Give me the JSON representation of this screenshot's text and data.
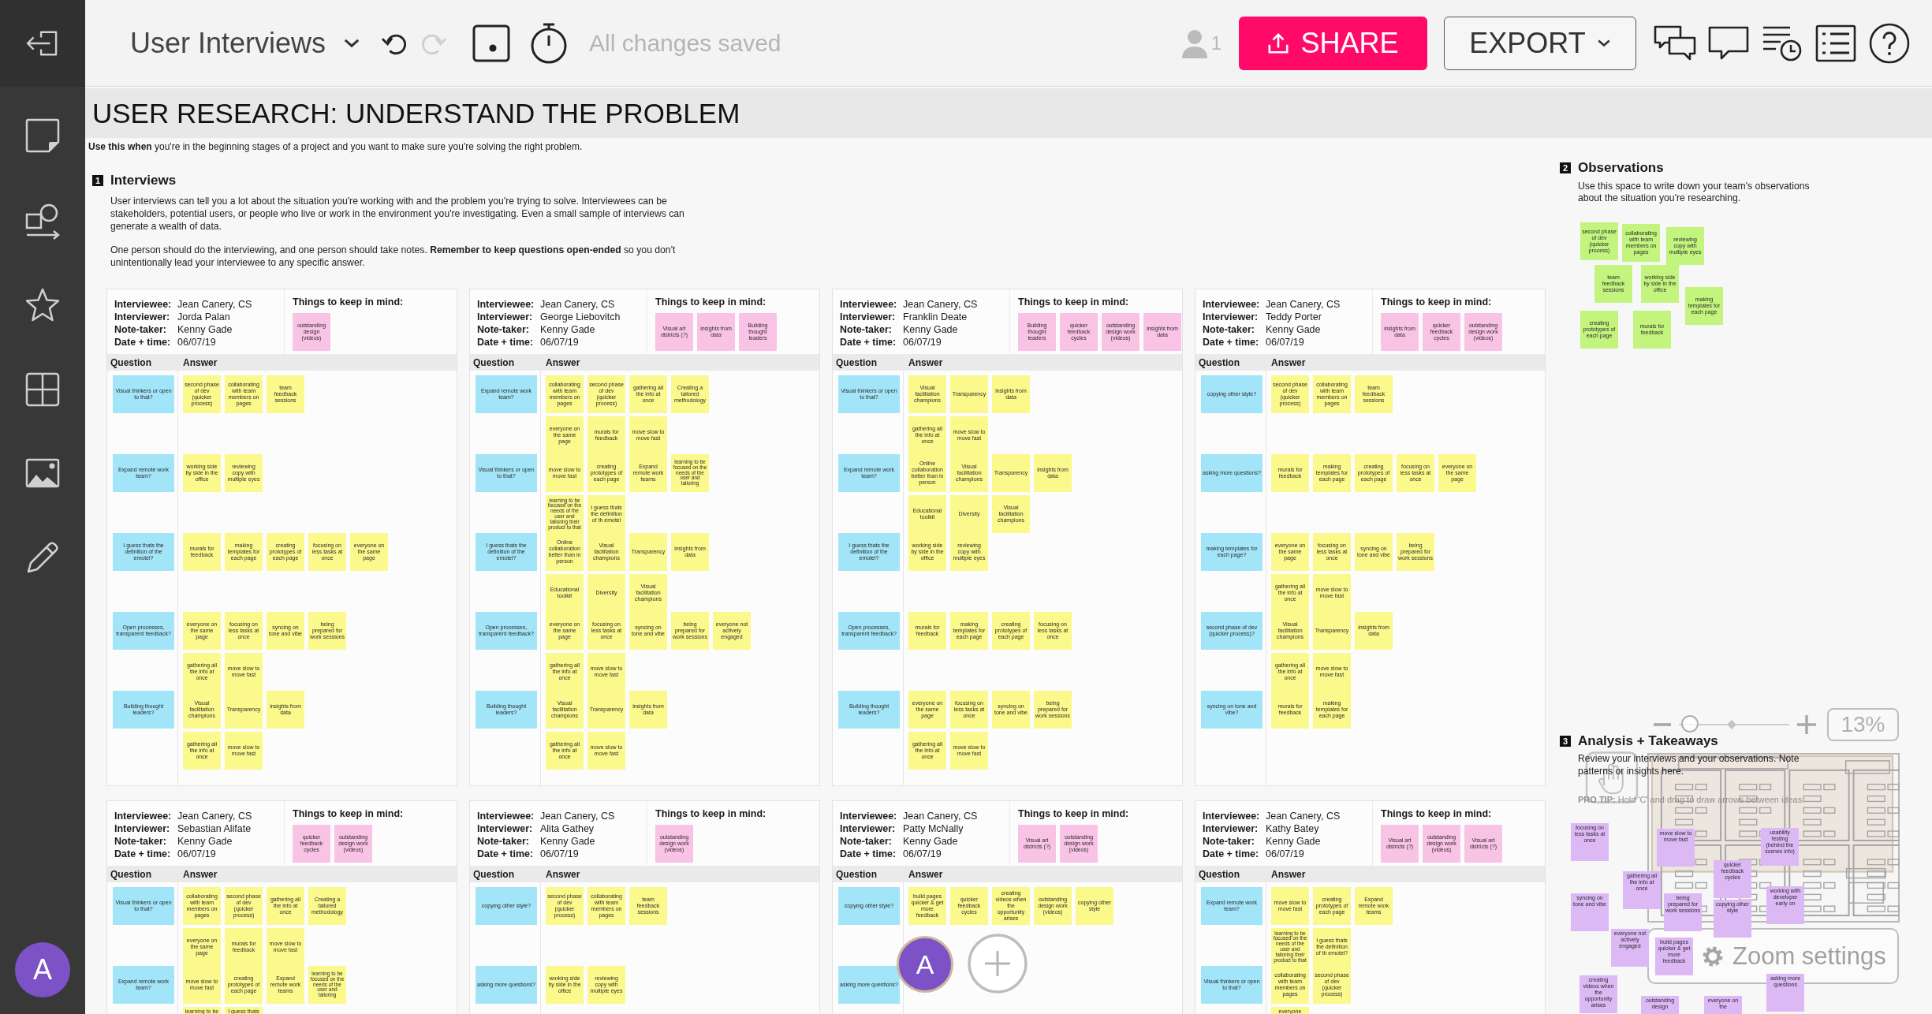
{
  "sidebar": {
    "avatar": "A"
  },
  "toolbar": {
    "title": "User Interviews",
    "history": [
      {
        "kind": "undo",
        "disabled": false
      },
      {
        "kind": "redo",
        "disabled": true
      }
    ],
    "save_status": "All changes saved",
    "collaborator_count": "1",
    "share_label": "SHARE",
    "export_label": "EXPORT"
  },
  "board": {
    "title": "USER RESEARCH: UNDERSTAND THE PROBLEM",
    "intro": "**Use this when** you're in the beginning stages of a project and you want to make sure you're solving the right problem.",
    "interviews": {
      "number": "1",
      "heading": "Interviews",
      "paragraphs": [
        "User interviews can tell you a lot about the situation you're working with and the problem you're trying to solve. Interviewees can be stakeholders, potential users, or people who live or work in the environment you're investigating. Even a small sample of interviews can generate a wealth of data.",
        "One person should do the interviewing, and one person should take notes. **Remember to keep questions open-ended** so you don't unintentionally lead your interviewee to any specific answer."
      ],
      "cards": [
        {
          "fields": [
            {
              "label": "Interviewee:",
              "value": "Jean Canery, CS"
            },
            {
              "label": "Interviewer:",
              "value": "Jorda Palan"
            },
            {
              "label": "Note-taker:",
              "value": "Kenny Gade"
            },
            {
              "label": "Date + time:",
              "value": "06/07/19"
            }
          ],
          "keep_heading": "Things to keep in mind:",
          "keep_notes": [
            "outstanding design (videos)"
          ],
          "columns": [
            "Question",
            "Answer"
          ],
          "rows": [
            {
              "question": "Visual thinkers or open to that?",
              "answers": [
                [
                  "second phase of dev (quicker process)",
                  "collaborating with team members on pages",
                  "team feedback sessions"
                ]
              ]
            },
            {
              "question": "Expand remote work team?",
              "answers": [
                [
                  "working side by side in the office",
                  "reviewing copy with multiple eyes"
                ]
              ]
            },
            {
              "question": "I guess thats the definition of the emotel?",
              "answers": [
                [
                  "murals for feedback",
                  "making templates for each page",
                  "creating prototypes of each page",
                  "focusing on less tasks at once",
                  "everyone on the same page"
                ]
              ]
            },
            {
              "question": "Open processes, transparent feedback?",
              "answers": [
                [
                  "everyone on the same page",
                  "focusing on less tasks at once",
                  "syncing on tone and vibe",
                  "being prepared for work sessions"
                ],
                [
                  "gathering all the info at once",
                  "move slow to move fast"
                ]
              ]
            },
            {
              "question": "Building thought leaders?",
              "answers": [
                [
                  "Visual facilitation champions",
                  "Transparency",
                  "insights from data"
                ],
                [
                  "gathering all the info at once",
                  "move slow to move fast"
                ]
              ]
            }
          ]
        },
        {
          "fields": [
            {
              "label": "Interviewee:",
              "value": "Jean Canery, CS"
            },
            {
              "label": "Interviewer:",
              "value": "George Liebovitch"
            },
            {
              "label": "Note-taker:",
              "value": "Kenny Gade"
            },
            {
              "label": "Date + time:",
              "value": "06/07/19"
            }
          ],
          "keep_heading": "Things to keep in mind:",
          "keep_notes": [
            "Visual art districts (?)",
            "insights from data",
            "Building thought leaders"
          ],
          "columns": [
            "Question",
            "Answer"
          ],
          "rows": [
            {
              "question": "Expand remote work team?",
              "answers": [
                [
                  "collaborating with team members on pages",
                  "second phase of dev (quicker process)",
                  "gathering all the info at once",
                  "Creating a tailored methodology"
                ],
                [
                  "everyone on the same page",
                  "murals for feedback",
                  "move slow to move fast"
                ]
              ]
            },
            {
              "question": "Visual thinkers or open to that?",
              "answers": [
                [
                  "move slow to move fast",
                  "creating prototypes of each page",
                  "Expand remote work teams",
                  "learning to be focused on the needs of the user and tailoring"
                ],
                [
                  "learning to be focused on the needs of the user and tailoring their product to that",
                  "I guess thats the definition of th emotel"
                ]
              ]
            },
            {
              "question": "I guess thats the definition of the emotel?",
              "answers": [
                [
                  "Online collaboration better than in person",
                  "Visual facilitation champions",
                  "Transparency",
                  "insights from data"
                ],
                [
                  "Educational toolkit",
                  "Diversity",
                  "Visual facilitation champions"
                ]
              ]
            },
            {
              "question": "Open processes, transparent feedback?",
              "answers": [
                [
                  "everyone on the same page",
                  "focusing on less tasks at once",
                  "syncing on tone and vibe",
                  "being prepared for work sessions",
                  "everyone not actively engaged"
                ],
                [
                  "gathering all the info at once",
                  "move slow to move fast"
                ]
              ]
            },
            {
              "question": "Building thought leaders?",
              "answers": [
                [
                  "Visual facilitation champions",
                  "Transparency",
                  "insights from data"
                ],
                [
                  "gathering all the info at once",
                  "move slow to move fast"
                ]
              ]
            }
          ]
        },
        {
          "fields": [
            {
              "label": "Interviewee:",
              "value": "Jean Canery, CS"
            },
            {
              "label": "Interviewer:",
              "value": "Franklin Deate"
            },
            {
              "label": "Note-taker:",
              "value": "Kenny Gade"
            },
            {
              "label": "Date + time:",
              "value": "06/07/19"
            }
          ],
          "keep_heading": "Things to keep in mind:",
          "keep_notes": [
            "Building thought leaders",
            "quicker feedback cycles",
            "outstanding design work (videos)",
            "insights from data"
          ],
          "columns": [
            "Question",
            "Answer"
          ],
          "rows": [
            {
              "question": "Visual thinkers or open to that?",
              "answers": [
                [
                  "Visual facilitation champions",
                  "Transparency",
                  "insights from data"
                ],
                [
                  "gathering all the info at once",
                  "move slow to move fast"
                ]
              ]
            },
            {
              "question": "Expand remote work team?",
              "answers": [
                [
                  "Online collaboration better than in person",
                  "Visual facilitation champions",
                  "Transparency",
                  "insights from data"
                ],
                [
                  "Educational toolkit",
                  "Diversity",
                  "Visual facilitation champions"
                ]
              ]
            },
            {
              "question": "I guess thats the definition of the emotel?",
              "answers": [
                [
                  "working side by side in the office",
                  "reviewing copy with multiple eyes"
                ]
              ]
            },
            {
              "question": "Open processes, transparent feedback?",
              "answers": [
                [
                  "murals for feedback",
                  "making templates for each page",
                  "creating prototypes of each page",
                  "focusing on less tasks at once"
                ]
              ]
            },
            {
              "question": "Building thought leaders?",
              "answers": [
                [
                  "everyone on the same page",
                  "focusing on less tasks at once",
                  "syncing on tone and vibe",
                  "being prepared for work sessions"
                ],
                [
                  "gathering all the info at once",
                  "move slow to move fast"
                ]
              ]
            }
          ]
        },
        {
          "fields": [
            {
              "label": "Interviewee:",
              "value": "Jean Canery, CS"
            },
            {
              "label": "Interviewer:",
              "value": "Teddy Porter"
            },
            {
              "label": "Note-taker:",
              "value": "Kenny Gade"
            },
            {
              "label": "Date + time:",
              "value": "06/07/19"
            }
          ],
          "keep_heading": "Things to keep in mind:",
          "keep_notes": [
            "insights from data",
            "quicker feedback cycles",
            "outstanding design work (videos)"
          ],
          "columns": [
            "Question",
            "Answer"
          ],
          "rows": [
            {
              "question": "copying other style?",
              "answers": [
                [
                  "second phase of dev (quicker process)",
                  "collaborating with team members on pages",
                  "team feedback sessions"
                ]
              ]
            },
            {
              "question": "asking more questions?",
              "answers": [
                [
                  "murals for feedback",
                  "making templates for each page",
                  "creating prototypes of each page",
                  "focusing on less tasks at once",
                  "everyone on the same page"
                ]
              ]
            },
            {
              "question": "making templates for each page?",
              "answers": [
                [
                  "everyone on the same page",
                  "focusing on less tasks at once",
                  "syncing on tone and vibe",
                  "being prepared for work sessions"
                ],
                [
                  "gathering all the info at once",
                  "move slow to move fast"
                ]
              ]
            },
            {
              "question": "second phase of dev (quicker process)?",
              "answers": [
                [
                  "Visual facilitation champions",
                  "Transparency",
                  "insights from data"
                ],
                [
                  "gathering all the info at once",
                  "move slow to move fast"
                ]
              ]
            },
            {
              "question": "syncing on tone and vibe?",
              "answers": [
                [
                  "murals for feedback",
                  "making templates for each page"
                ]
              ]
            }
          ]
        },
        {
          "fields": [
            {
              "label": "Interviewee:",
              "value": "Jean Canery, CS"
            },
            {
              "label": "Interviewer:",
              "value": "Sebastian Alifate"
            },
            {
              "label": "Note-taker:",
              "value": "Kenny Gade"
            },
            {
              "label": "Date + time:",
              "value": "06/07/19"
            }
          ],
          "keep_heading": "Things to keep in mind:",
          "keep_notes": [
            "quicker feedback cycles",
            "outstanding design work (videos)"
          ],
          "columns": [
            "Question",
            "Answer"
          ],
          "rows": [
            {
              "question": "Visual thinkers or open to that?",
              "answers": [
                [
                  "collaborating with team members on pages",
                  "second phase of dev (quicker process)",
                  "gathering all the info at once",
                  "Creating a tailored methodology"
                ],
                [
                  "everyone on the same page",
                  "murals for feedback",
                  "move slow to move fast"
                ]
              ]
            },
            {
              "question": "Expand remote work team?",
              "answers": [
                [
                  "move slow to move fast",
                  "creating prototypes of each page",
                  "Expand remote work teams",
                  "learning to be focused on the needs of the user and tailoring"
                ],
                [
                  "learning to be",
                  "I guess thats"
                ]
              ]
            }
          ]
        },
        {
          "fields": [
            {
              "label": "Interviewee:",
              "value": "Jean Canery, CS"
            },
            {
              "label": "Interviewer:",
              "value": "Alita Gathey"
            },
            {
              "label": "Note-taker:",
              "value": "Kenny Gade"
            },
            {
              "label": "Date + time:",
              "value": "06/07/19"
            }
          ],
          "keep_heading": "Things to keep in mind:",
          "keep_notes": [
            "outstanding design work (videos)"
          ],
          "columns": [
            "Question",
            "Answer"
          ],
          "rows": [
            {
              "question": "copying other style?",
              "answers": [
                [
                  "second phase of dev (quicker process)",
                  "collaborating with team members on pages",
                  "team feedback sessions"
                ]
              ]
            },
            {
              "question": "asking more questions?",
              "answers": [
                [
                  "working side by side in the office",
                  "reviewing copy with multiple eyes"
                ]
              ]
            }
          ]
        },
        {
          "fields": [
            {
              "label": "Interviewee:",
              "value": "Jean Canery, CS"
            },
            {
              "label": "Interviewer:",
              "value": "Patty McNally"
            },
            {
              "label": "Note-taker:",
              "value": "Kenny Gade"
            },
            {
              "label": "Date + time:",
              "value": "06/07/19"
            }
          ],
          "keep_heading": "Things to keep in mind:",
          "keep_notes": [
            "Visual art districts (?)",
            "outstanding design work (videos)"
          ],
          "columns": [
            "Question",
            "Answer"
          ],
          "rows": [
            {
              "question": "copying other style?",
              "answers": [
                [
                  "build pages quicker & get more feedback",
                  "quicker feedback cycles",
                  "creating videos when the opportunity arises",
                  "outstanding design work (videos)",
                  "copying other style"
                ]
              ]
            },
            {
              "question": "asking more questions?"
            }
          ]
        },
        {
          "fields": [
            {
              "label": "Interviewee:",
              "value": "Jean Canery, CS"
            },
            {
              "label": "Interviewer:",
              "value": "Kathy Batey"
            },
            {
              "label": "Note-taker:",
              "value": "Kenny Gade"
            },
            {
              "label": "Date + time:",
              "value": "06/07/19"
            }
          ],
          "keep_heading": "Things to keep in mind:",
          "keep_notes": [
            "Visual art districts (?)",
            "outstanding design work (videos)",
            "Visual art districts (?)"
          ],
          "columns": [
            "Question",
            "Answer"
          ],
          "rows": [
            {
              "question": "Expand remote work team?",
              "answers": [
                [
                  "move slow to move fast",
                  "creating prototypes of each page",
                  "Expand remote work teams"
                ],
                [
                  "learning to be focused on the needs of the user and tailoring their product to that",
                  "I guess thats the definition of th emotel?"
                ]
              ]
            },
            {
              "question": "Visual thinkers or open to that?",
              "answers": [
                [
                  "collaborating with team members on pages",
                  "second phase of dev (quicker process)"
                ],
                [
                  "everyone"
                ]
              ]
            }
          ]
        }
      ]
    },
    "observations": {
      "number": "2",
      "heading": "Observations",
      "text": "Use this space to write down your team's observations about the situation you're researching.",
      "notes": [
        "second phase of dev (quicker process)",
        "collaborating with team members on pages",
        "reviewing copy with multiple eyes",
        "team feedback sessions",
        "working side by side in the office",
        "making templates for each page",
        "creating prototypes of each page",
        "murals for feedback"
      ]
    },
    "analysis": {
      "number": "3",
      "heading": "Analysis + Takeaways",
      "text": "Review your interviews and your observations. Note patterns or insights here.",
      "tip": "**PRO TIP:** Hold 'C' and drag to draw arrows between ideas.",
      "notes": [
        "focusing on less tasks at once",
        "gathering all the info at once",
        "syncing on tone and vibe",
        "everyone not actively engaged",
        "creating videos when the opportunity arises",
        "outstanding design",
        "everyone on the",
        "move slow to move fast",
        "usability testing (behind the scenes info)",
        "quicker feedback cycles",
        "being prepared for work sessions",
        "working with developer early on",
        "build pages quicker & get more feedback",
        "copying other style",
        "asking more questions"
      ]
    }
  },
  "presence": {
    "avatar": "A"
  },
  "zoom": {
    "level": 0.1,
    "value": "13%",
    "settings_label": "Zoom settings"
  }
}
